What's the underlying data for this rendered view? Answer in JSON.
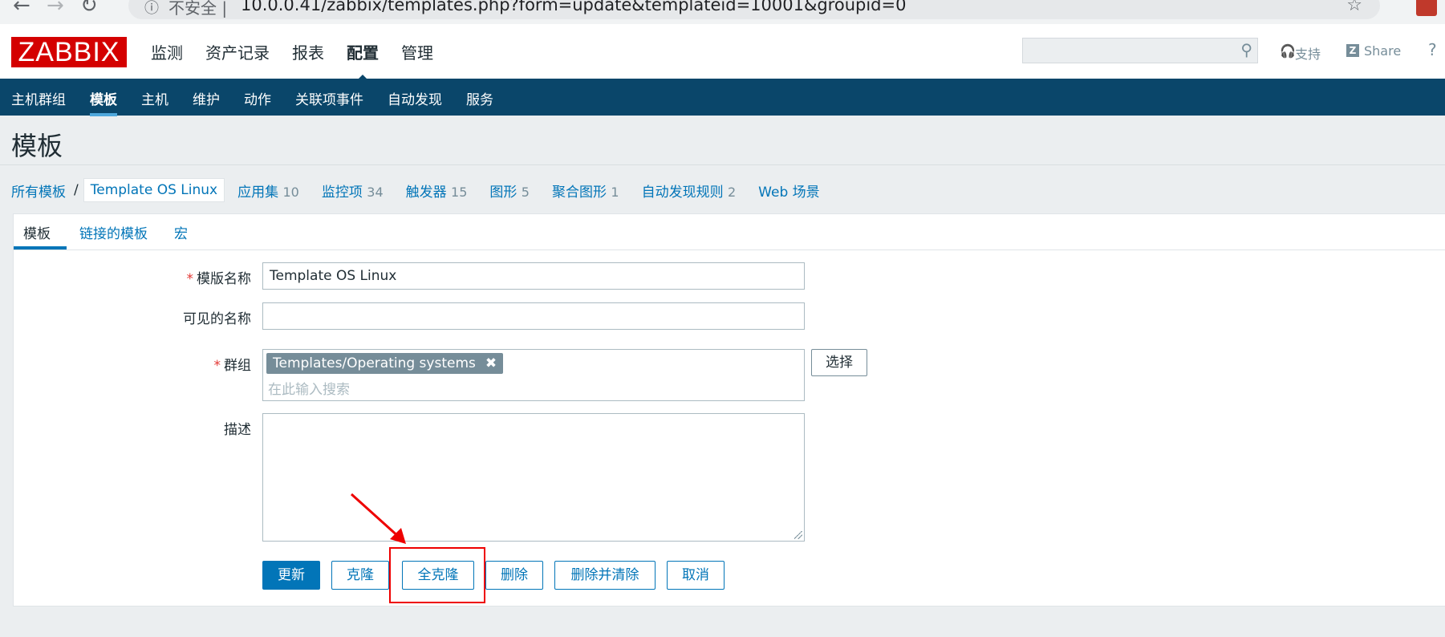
{
  "browser": {
    "back_icon": "←",
    "forward_icon": "→",
    "reload_icon": "↻",
    "info_icon": "ⓘ",
    "insecure_label": "不安全 |",
    "url": "10.0.0.41/zabbix/templates.php?form=update&templateid=10001&groupid=0",
    "star_icon": "☆"
  },
  "header": {
    "logo": "ZABBIX",
    "menu": [
      "监测",
      "资产记录",
      "报表",
      "配置",
      "管理"
    ],
    "active_menu": "配置",
    "search_icon": "🔍",
    "support_label": "支持",
    "support_icon": "🎧",
    "share_label": "Share",
    "share_icon": "Z",
    "help_icon": "?"
  },
  "subnav": {
    "items": [
      "主机群组",
      "模板",
      "主机",
      "维护",
      "动作",
      "关联项事件",
      "自动发现",
      "服务"
    ],
    "active": "模板"
  },
  "page": {
    "title": "模板"
  },
  "breadcrumb": {
    "all_templates": "所有模板",
    "separator": "/",
    "current": "Template OS Linux",
    "links": [
      {
        "label": "应用集",
        "count": "10"
      },
      {
        "label": "监控项",
        "count": "34"
      },
      {
        "label": "触发器",
        "count": "15"
      },
      {
        "label": "图形",
        "count": "5"
      },
      {
        "label": "聚合图形",
        "count": "1"
      },
      {
        "label": "自动发现规则",
        "count": "2"
      },
      {
        "label": "Web 场景",
        "count": ""
      }
    ]
  },
  "tabs": [
    "模板",
    "链接的模板",
    "宏"
  ],
  "form": {
    "required_mark": "*",
    "template_name_label": "模版名称",
    "template_name_value": "Template OS Linux",
    "visible_name_label": "可见的名称",
    "visible_name_value": "",
    "groups_label": "群组",
    "group_chip": "Templates/Operating systems",
    "group_chip_close": "✖",
    "group_placeholder": "在此输入搜索",
    "select_button": "选择",
    "description_label": "描述",
    "description_value": ""
  },
  "buttons": {
    "update": "更新",
    "clone": "克隆",
    "full_clone": "全克隆",
    "delete": "删除",
    "delete_and_clear": "删除并清除",
    "cancel": "取消"
  },
  "colors": {
    "brand_red": "#d40000",
    "nav_blue": "#0a466a",
    "link_blue": "#0275b8",
    "annotation_red": "#e00000"
  }
}
